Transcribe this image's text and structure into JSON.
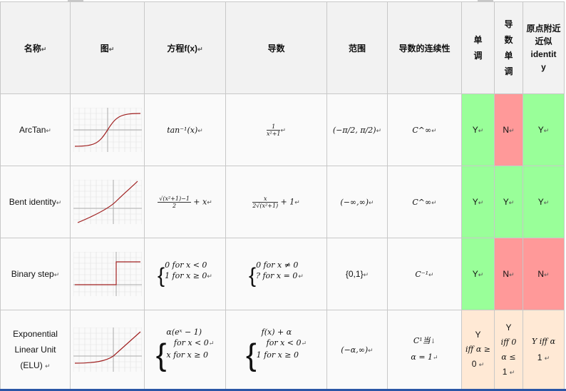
{
  "headers": {
    "name": "名称",
    "graph": "图",
    "equation": "方程f(x)",
    "derivative": "导数",
    "range": "范围",
    "continuity": "导数的连续性",
    "monotonic": "单调",
    "deriv_monotonic": "导数单调",
    "identity": "原点附近近似identity"
  },
  "rows": [
    {
      "name": "ArcTan",
      "equation": "tan⁻¹(x)",
      "derivative_num": "1",
      "derivative_den": "x²+1",
      "range": "(−π/2, π/2)",
      "continuity": "C^∞",
      "monotonic": "Y",
      "deriv_monotonic": "N",
      "identity": "Y",
      "graph_icon": "arctan-curve"
    },
    {
      "name": "Bent identity",
      "equation_num": "√(x²+1)−1",
      "equation_den": "2",
      "equation_tail": "+ x",
      "derivative_num": "x",
      "derivative_den": "2√(x²+1)",
      "derivative_tail": "+ 1",
      "range": "(−∞,∞)",
      "continuity": "C^∞",
      "monotonic": "Y",
      "deriv_monotonic": "Y",
      "identity": "Y",
      "graph_icon": "bent-identity-curve"
    },
    {
      "name": "Binary step",
      "equation_line1": "0 for x < 0",
      "equation_line2": "1 for x ≥ 0",
      "derivative_line1": "0 for x ≠ 0",
      "derivative_line2": "? for x = 0",
      "range": "{0,1}",
      "continuity": "C⁻¹",
      "monotonic": "Y",
      "deriv_monotonic": "N",
      "identity": "N",
      "graph_icon": "step-function"
    },
    {
      "name_line1": "Exponential",
      "name_line2": "Linear Unit",
      "name_line3": "(ELU)",
      "equation_line1": "α(eˣ − 1)",
      "equation_line2": "for x < 0",
      "equation_line3": "x for x ≥ 0",
      "derivative_line1": "f(x) + α",
      "derivative_line2": "for x < 0",
      "derivative_line3": "1 for x ≥ 0",
      "range": "(−α,∞)",
      "continuity_line1": "C¹当",
      "continuity_line2": "α = 1",
      "monotonic_line1": "Y",
      "monotonic_line2": "iff α ≥",
      "monotonic_line3": "0",
      "deriv_monotonic_line1": "Y",
      "deriv_monotonic_line2": "iff 0",
      "deriv_monotonic_line3": "α ≤",
      "deriv_monotonic_line4": "1",
      "identity_line1": "Y   iff α",
      "identity_line2": "1",
      "graph_icon": "elu-curve"
    }
  ],
  "colors": {
    "yes": "#99ff99",
    "no": "#ff9999",
    "partial": "#ffe9d5",
    "curve": "#a02020",
    "grid": "#e0e0e0",
    "axis": "#999999"
  }
}
